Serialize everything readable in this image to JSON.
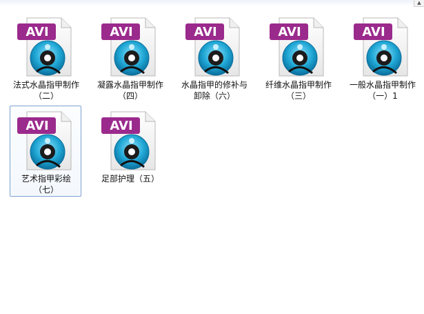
{
  "badge_text": "AVI",
  "colors": {
    "badge_purple": "#9b2a8d",
    "reel_blue": "#1fa6d4",
    "selection_border": "#7da2ce"
  },
  "files": [
    {
      "name": "法式水晶指甲制作（二）",
      "icon": "avi-video-file-icon",
      "selected": false
    },
    {
      "name": "凝露水晶指甲制作（四）",
      "icon": "avi-video-file-icon",
      "selected": false
    },
    {
      "name": "水晶指甲的修补与卸除（六）",
      "icon": "avi-video-file-icon",
      "selected": false
    },
    {
      "name": "纤维水晶指甲制作（三）",
      "icon": "avi-video-file-icon",
      "selected": false
    },
    {
      "name": "一般水晶指甲制作（一）1",
      "icon": "avi-video-file-icon",
      "selected": false
    },
    {
      "name": "艺术指甲彩绘（七）",
      "icon": "avi-video-file-icon",
      "selected": true
    },
    {
      "name": "足部护理（五）",
      "icon": "avi-video-file-icon",
      "selected": false
    }
  ]
}
